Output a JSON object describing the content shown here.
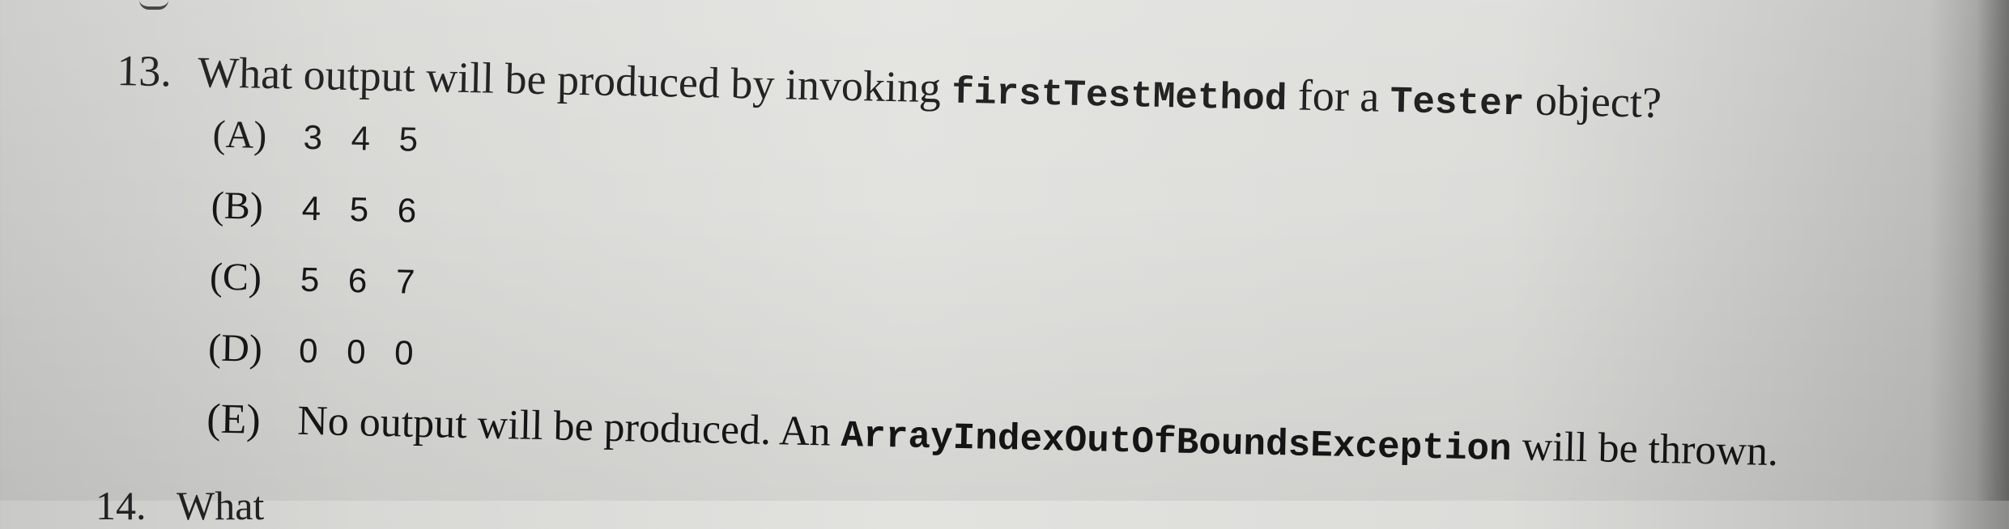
{
  "question": {
    "number": "13.",
    "text_before": "What output will be produced by invoking ",
    "code_method": "firstTestMethod",
    "text_middle": " for a ",
    "code_class": "Tester",
    "text_after": " object?"
  },
  "choices": [
    {
      "letter": "(A)",
      "value": "3 4 5"
    },
    {
      "letter": "(B)",
      "value": "4 5 6"
    },
    {
      "letter": "(C)",
      "value": "5 6 7"
    },
    {
      "letter": "(D)",
      "value": "0 0 0"
    }
  ],
  "choice_e": {
    "letter": "(E)",
    "text_before": "No output will be produced. An ",
    "code_exception": "ArrayIndexOutOfBoundsException",
    "text_after": " will be thrown."
  },
  "next_question": {
    "number": "14.",
    "text": "What"
  }
}
